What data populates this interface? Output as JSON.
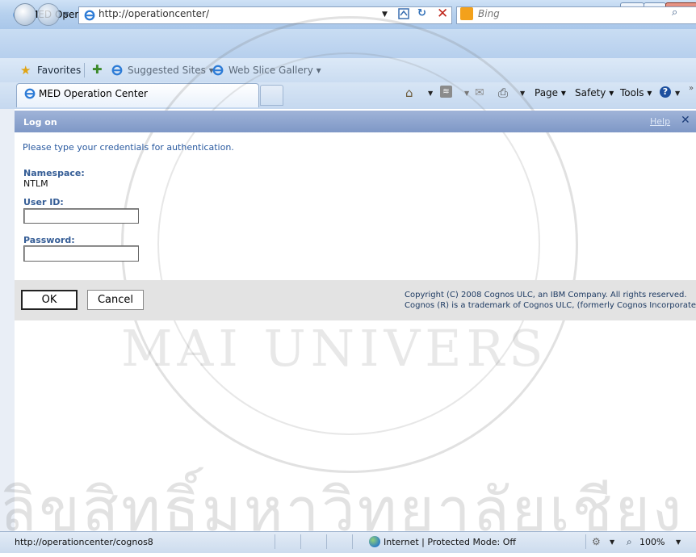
{
  "window": {
    "title": "MED Operation Center - Windows Internet Explorer"
  },
  "address_bar": {
    "url": "http://operationcenter/",
    "search_placeholder": "Bing"
  },
  "favorites_bar": {
    "favorites_label": "Favorites",
    "items": [
      "Suggested Sites ▾",
      "Web Slice Gallery ▾"
    ]
  },
  "tabs": [
    {
      "label": "MED Operation Center",
      "active": true
    }
  ],
  "command_bar": {
    "page": "Page ▾",
    "safety": "Safety ▾",
    "tools": "Tools ▾"
  },
  "logon": {
    "title": "Log on",
    "help_link": "Help",
    "instruction": "Please type your credentials for authentication.",
    "namespace_label": "Namespace:",
    "namespace_value": "NTLM",
    "userid_label": "User ID:",
    "userid_value": "",
    "password_label": "Password:",
    "password_value": "",
    "ok_label": "OK",
    "cancel_label": "Cancel",
    "copyright_line1": "Copyright (C) 2008 Cognos ULC, an IBM Company. All rights reserved.",
    "copyright_line2": "Cognos (R) is a trademark of Cognos ULC, (formerly Cognos Incorporated)."
  },
  "watermark": {
    "university_text": "MAI UNIVERS",
    "thai_text": "ลิขสิทธิ์มหาวิทยาลัยเชียง"
  },
  "status_bar": {
    "url": "http://operationcenter/cognos8",
    "zone": "Internet | Protected Mode: Off",
    "zoom": "100%"
  },
  "colors": {
    "header_blue": "#8ea5cf",
    "label_blue": "#355d96",
    "footer_gray": "#e3e3e3"
  }
}
